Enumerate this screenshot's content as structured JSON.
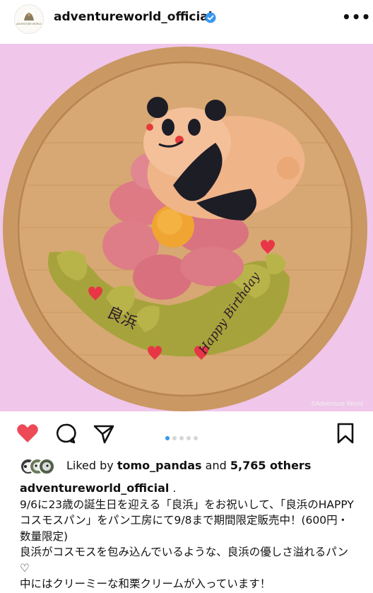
{
  "post": {
    "username": "adventureworld_official",
    "more_label": "•••",
    "avatar_text": "ADVENTURE WORLD",
    "photo_watermark": "©Adventure World",
    "photo_text": {
      "kanji": "良浜",
      "birthday": "Happy Birthday"
    }
  },
  "carousel": {
    "total": 5,
    "active_index": 0
  },
  "likes": {
    "prefix": "Liked by ",
    "user": "tomo_pandas",
    "middle": " and ",
    "count": "5,765 others"
  },
  "caption": {
    "username": "adventureworld_official",
    "suffix": " .",
    "lines": [
      "9/6に23歳の誕生日を迎える「良浜」をお祝いして、「良浜のHAPPY コスモスパン」をパン工房にて9/8まで期間限定販売中！(600円・数量限定)",
      "良浜がコスモスを包み込んでいるような、良浜の優しさ溢れるパン♡",
      "中にはクリーミーな和栗クリームが入っています！"
    ]
  },
  "icons": [
    "avatar-logo-icon",
    "verified-badge-icon",
    "more-options-icon",
    "like-heart-icon",
    "comment-icon",
    "share-icon",
    "bookmark-icon"
  ],
  "colors": {
    "heart": "#ed4956",
    "verified": "#3897f0",
    "dot_active": "#3897f0",
    "background_pink": "#f0c6ea"
  }
}
